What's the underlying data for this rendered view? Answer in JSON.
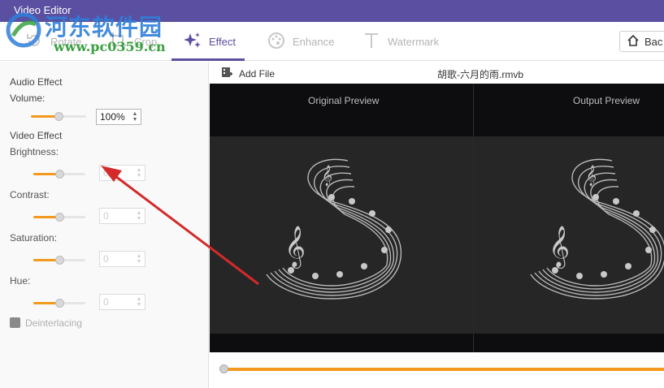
{
  "window": {
    "title": "Video Editor"
  },
  "toolbar": {
    "tabs": [
      {
        "label": "Rotate",
        "icon": "rotate-icon"
      },
      {
        "label": "Crop",
        "icon": "crop-icon"
      },
      {
        "label": "Effect",
        "icon": "sparkle-icon",
        "active": true
      },
      {
        "label": "Enhance",
        "icon": "palette-icon"
      },
      {
        "label": "Watermark",
        "icon": "text-t-icon"
      }
    ],
    "back_label": "Bac"
  },
  "watermark": {
    "site": "河东软件园",
    "url": "www.pc0359.cn"
  },
  "effect_panel": {
    "audio_effect": "Audio Effect",
    "volume_label": "Volume:",
    "volume_value": "100%",
    "volume_level": 0.5,
    "video_effect": "Video Effect",
    "brightness_label": "Brightness:",
    "brightness_value": "0",
    "contrast_label": "Contrast:",
    "contrast_value": "0",
    "saturation_label": "Saturation:",
    "saturation_value": "0",
    "hue_label": "Hue:",
    "hue_value": "0",
    "deinterlacing_label": "Deinterlacing"
  },
  "preview": {
    "add_file": "Add File",
    "filename": "胡歌-六月的雨.rmvb",
    "original_label": "Original Preview",
    "output_label": "Output Preview"
  },
  "colors": {
    "accent": "#5a4fa0",
    "slider": "#f39a1e",
    "annotation_arrow": "#d42a2a"
  }
}
